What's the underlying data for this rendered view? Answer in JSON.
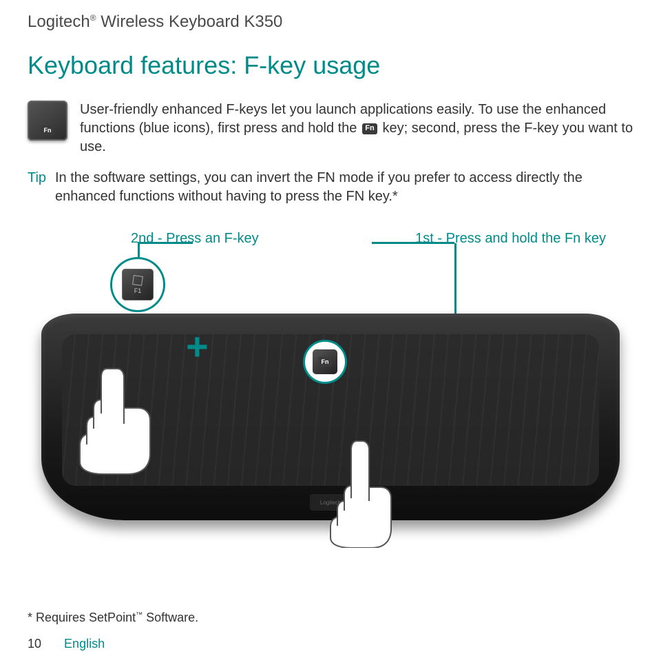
{
  "header": {
    "brand": "Logitech",
    "reg": "®",
    "product": "Wireless Keyboard K350"
  },
  "title": "Keyboard features: F-key usage",
  "intro": {
    "line1": "User-friendly enhanced F-keys let you launch applications easily.",
    "line2a": "To use the enhanced functions (blue icons), first press and hold the ",
    "line2b": " key; second, press the F-key you want to use.",
    "fn_label": "Fn"
  },
  "tip": {
    "label": "Tip",
    "text": "In the software settings, you can invert the FN mode if you prefer to access directly the enhanced functions without having to press the FN key.*"
  },
  "callouts": {
    "second_bold": "2nd",
    "second_rest": " - Press an F-key",
    "first_bold": "1st",
    "first_rest": " - Press and hold the Fn key"
  },
  "f1key": {
    "label": "F1"
  },
  "fnkey": {
    "label": "Fn"
  },
  "logo": "Logitech",
  "footnote": {
    "text_a": "* Requires SetPoint",
    "tm": "™",
    "text_b": " Software."
  },
  "footer": {
    "page": "10",
    "lang": "English"
  }
}
